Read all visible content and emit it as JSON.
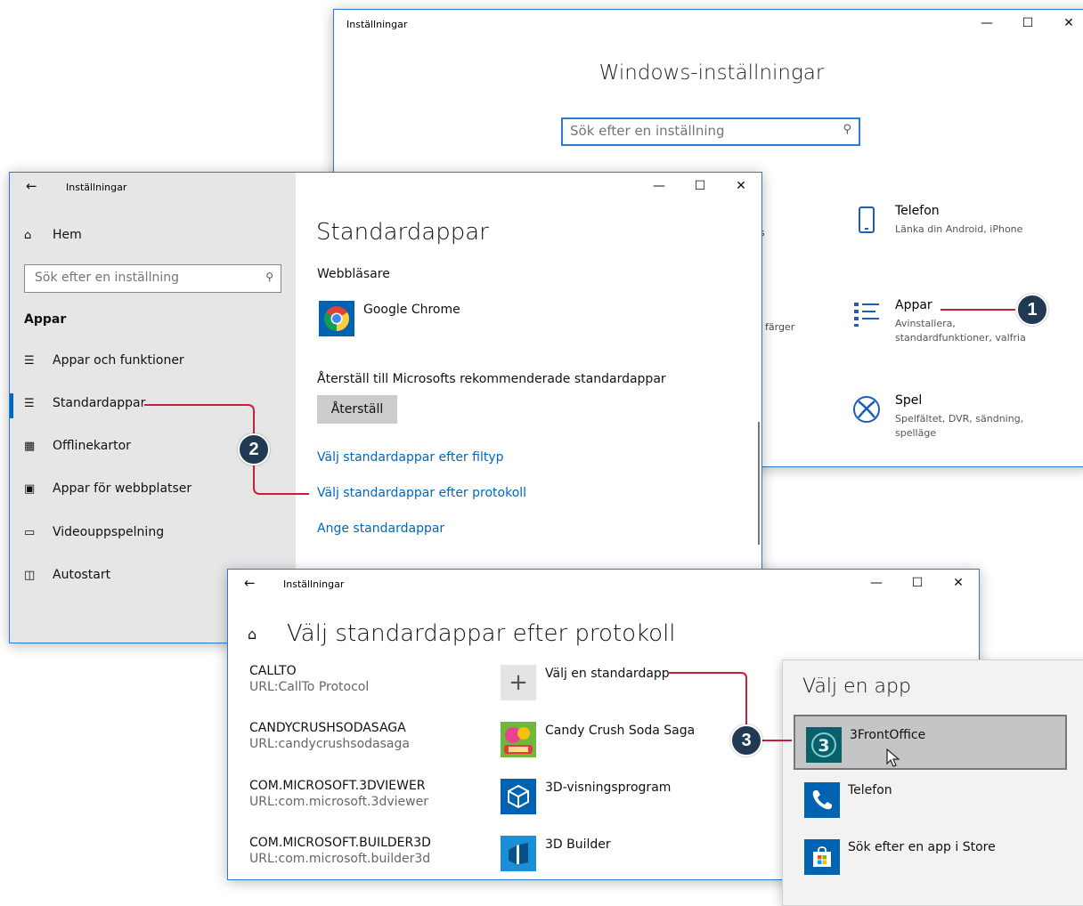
{
  "win_main": {
    "title": "Inställningar",
    "heading": "Windows-inställningar",
    "search_placeholder": "Sök efter en inställning",
    "partial_1": "s",
    "partial_2": "färger",
    "categories": [
      {
        "title": "Telefon",
        "subtitle": "Länka din Android, iPhone",
        "icon": "phone-icon"
      },
      {
        "title": "Appar",
        "subtitle": "Avinstallera, standardfunktioner, valfria",
        "icon": "apps-list-icon"
      },
      {
        "title": "Spel",
        "subtitle": "Spelfältet, DVR, sändning, spelläge",
        "icon": "xbox-icon"
      }
    ]
  },
  "win_default": {
    "title": "Inställningar",
    "sidebar": {
      "home": "Hem",
      "search_placeholder": "Sök efter en inställning",
      "section": "Appar",
      "items": [
        {
          "label": "Appar och funktioner",
          "icon": "apps-features-icon"
        },
        {
          "label": "Standardappar",
          "icon": "default-apps-icon",
          "selected": true
        },
        {
          "label": "Offlinekartor",
          "icon": "offline-maps-icon"
        },
        {
          "label": "Appar för webbplatser",
          "icon": "apps-websites-icon"
        },
        {
          "label": "Videouppspelning",
          "icon": "video-playback-icon"
        },
        {
          "label": "Autostart",
          "icon": "startup-icon"
        }
      ]
    },
    "main": {
      "heading": "Standardappar",
      "browser_label": "Webbläsare",
      "browser_app": "Google Chrome",
      "reset_text": "Återställ till Microsofts rekommenderade standardappar",
      "reset_button": "Återställ",
      "links": [
        "Välj standardappar efter filtyp",
        "Välj standardappar efter protokoll",
        "Ange standardappar"
      ]
    }
  },
  "win_protocol": {
    "title": "Inställningar",
    "heading": "Välj standardappar efter protokoll",
    "rows": [
      {
        "name": "CALLTO",
        "url": "URL:CallTo Protocol",
        "app": "Välj en standardapp",
        "tile": "plus"
      },
      {
        "name": "CANDYCRUSHSODASAGA",
        "url": "URL:candycrushsodasaga",
        "app": "Candy Crush Soda Saga",
        "tile": "candy"
      },
      {
        "name": "COM.MICROSOFT.3DVIEWER",
        "url": "URL:com.microsoft.3dviewer",
        "app": "3D-visningsprogram",
        "tile": "viewer"
      },
      {
        "name": "COM.MICROSOFT.BUILDER3D",
        "url": "URL:com.microsoft.builder3d",
        "app": "3D Builder",
        "tile": "builder"
      }
    ]
  },
  "app_picker": {
    "title": "Välj en app",
    "items": [
      {
        "label": "3FrontOffice",
        "selected": true
      },
      {
        "label": "Telefon"
      },
      {
        "label": "Sök efter en app i Store"
      }
    ]
  },
  "callouts": {
    "one": "1",
    "two": "2",
    "three": "3"
  },
  "colors": {
    "accent": "#0067c0",
    "callout_line": "#c4213a",
    "badge": "#1f3a52"
  }
}
